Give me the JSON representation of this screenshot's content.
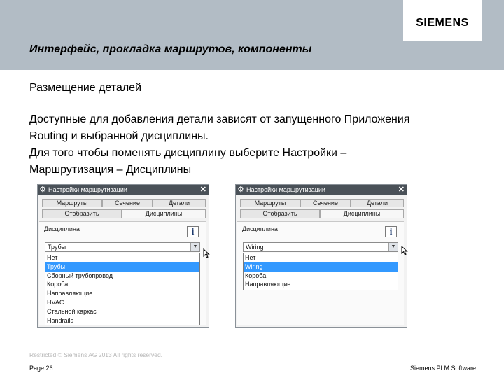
{
  "brand": {
    "logo": "SIEMENS"
  },
  "slide": {
    "title": "Интерфейс, прокладка маршрутов, компоненты",
    "subtitle": "Размещение деталей",
    "lines": [
      "Доступные для добавления детали зависят от запущенного Приложения",
      "Routing и выбранной дисциплины.",
      "Для того чтобы поменять дисциплину выберите Настройки –",
      "Маршрутизация – Дисциплины"
    ]
  },
  "dialogs": [
    {
      "title": "Настройки маршрутизации",
      "tabs": [
        "Маршруты",
        "Сечение",
        "Детали",
        "Отобразить",
        "Дисциплины"
      ],
      "active_tab": "Дисциплины",
      "field_label": "Дисциплина",
      "selected_value": "Трубы",
      "options": [
        "Нет",
        "Трубы",
        "Сборный трубопровод",
        "Короба",
        "Направляющие",
        "HVAC",
        "Стальной каркас",
        "Handrails"
      ],
      "selected_index": 1
    },
    {
      "title": "Настройки маршрутизации",
      "tabs": [
        "Маршруты",
        "Сечение",
        "Детали",
        "Отобразить",
        "Дисциплины"
      ],
      "active_tab": "Дисциплины",
      "field_label": "Дисциплина",
      "selected_value": "Wiring",
      "options": [
        "Нет",
        "Wiring",
        "Короба",
        "Направляющие"
      ],
      "selected_index": 1
    }
  ],
  "footer": {
    "copyright": "Restricted © Siemens AG 2013 All rights reserved.",
    "page": "Page 26",
    "brand": "Siemens PLM Software"
  },
  "colors": {
    "header_band": "#b2bcc5",
    "dialog_titlebar": "#4a5158",
    "selection": "#3399ff"
  }
}
